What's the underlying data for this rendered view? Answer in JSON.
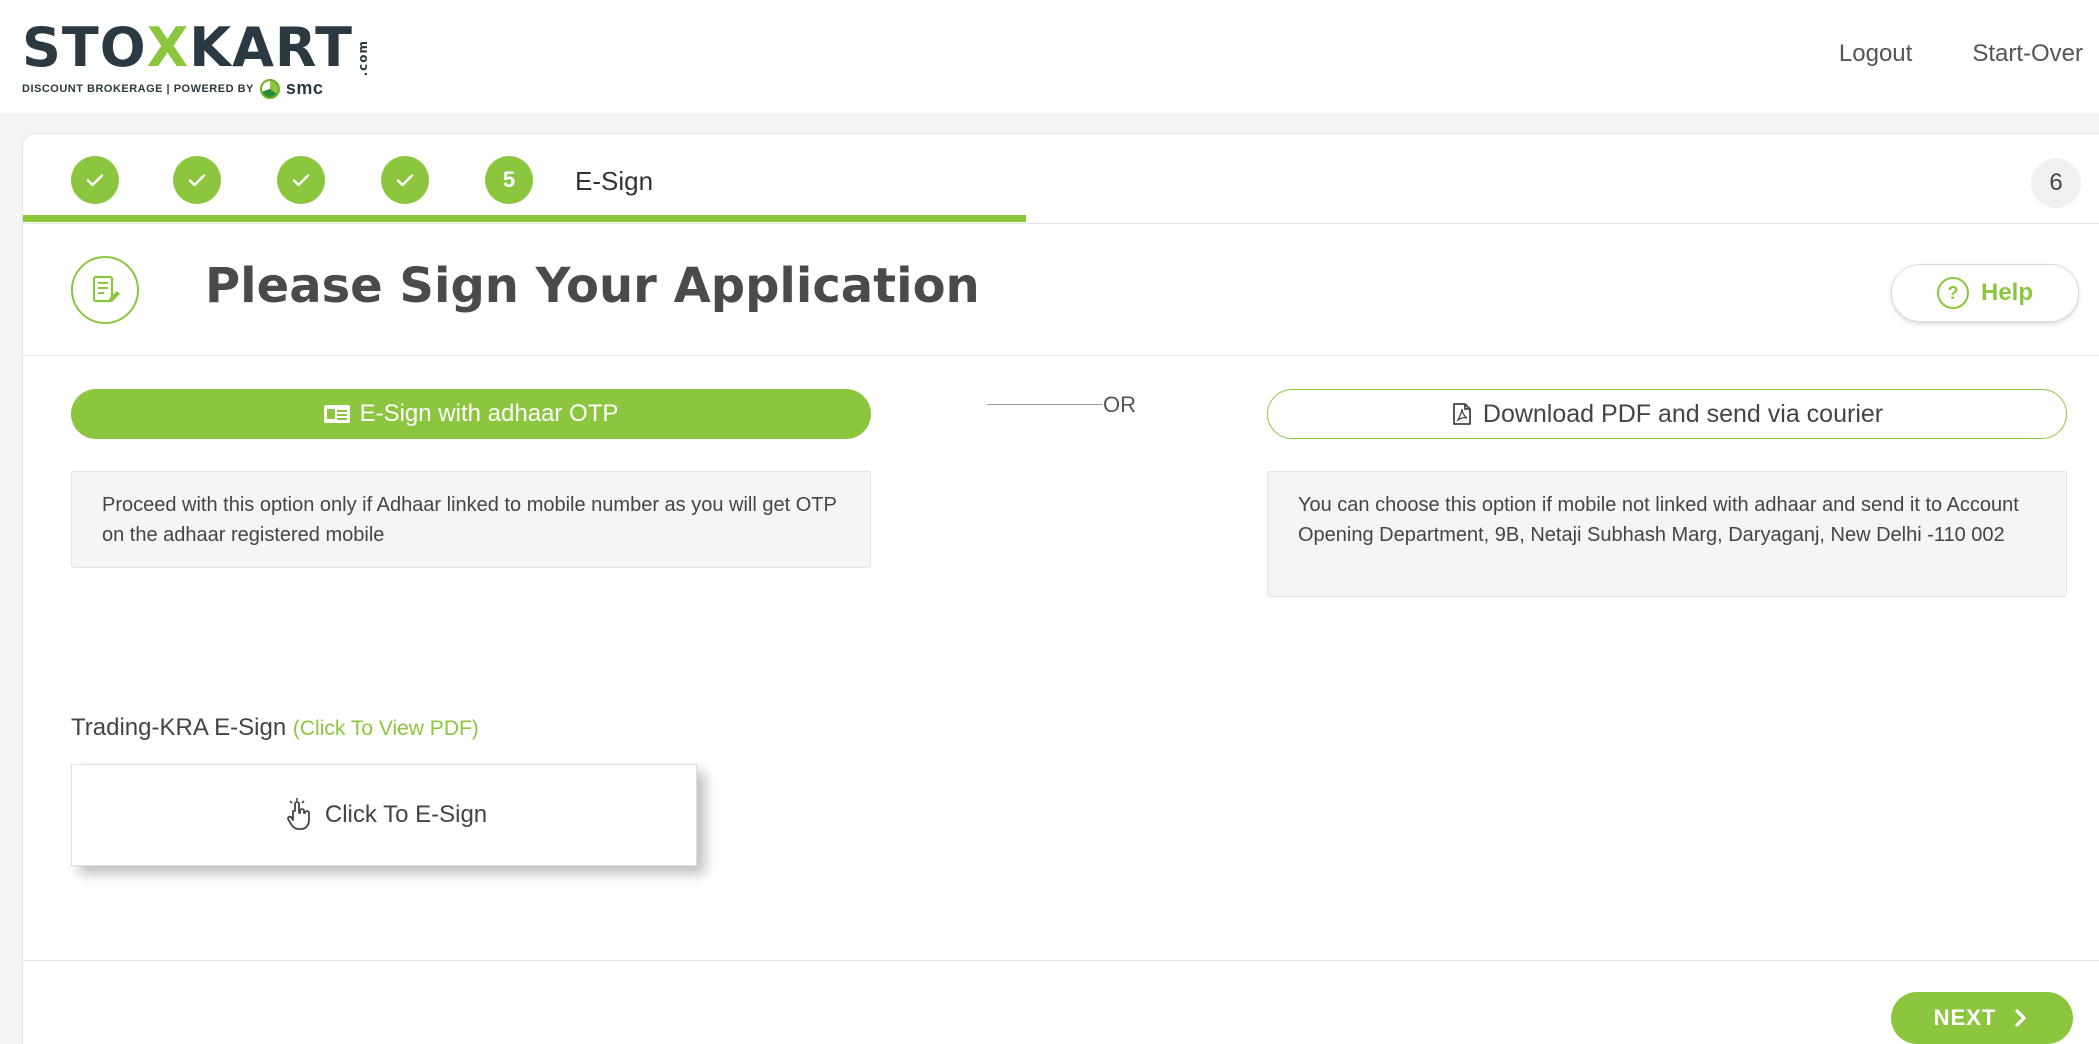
{
  "brand": {
    "name_part1": "STO",
    "name_x": "X",
    "name_part2": "KART",
    "tld": ".com",
    "tagline": "DISCOUNT BROKERAGE | POWERED BY",
    "partner": "smc",
    "accent_color": "#8cc63f"
  },
  "header": {
    "logout": "Logout",
    "start_over": "Start-Over"
  },
  "steps": {
    "current_number": "5",
    "current_label": "E-Sign",
    "next_number": "6",
    "completed_count": 4
  },
  "page": {
    "title": "Please Sign Your Application",
    "help_label": "Help",
    "help_symbol": "?"
  },
  "options": {
    "esign_button": "E-Sign with adhaar OTP",
    "or_label": "OR",
    "download_button": "Download PDF and send via courier",
    "esign_info": "Proceed with this option only if Adhaar linked to mobile number as you will get OTP on the adhaar registered mobile",
    "download_info": "You can choose this option if mobile not linked with adhaar and send it to Account Opening Department, 9B, Netaji Subhash Marg, Daryaganj, New Delhi -110 002"
  },
  "kra": {
    "label": "Trading-KRA E-Sign ",
    "link": "(Click To View PDF)",
    "action": "Click To E-Sign"
  },
  "footer": {
    "next_label": "NEXT"
  }
}
